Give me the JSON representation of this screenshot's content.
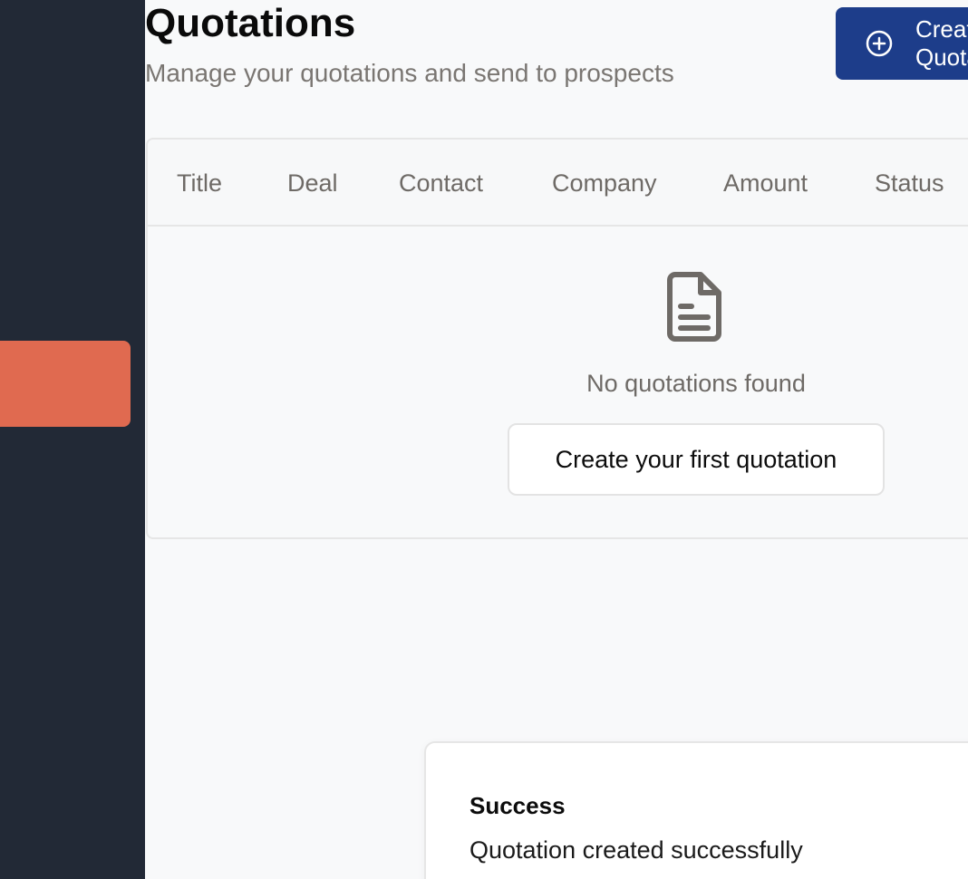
{
  "page": {
    "title": "Quotations",
    "subtitle": "Manage your quotations and send to prospects"
  },
  "actions": {
    "create_label": "Create Quotation",
    "create_icon": "plus-circle-icon"
  },
  "table": {
    "columns": [
      "Title",
      "Deal",
      "Contact",
      "Company",
      "Amount",
      "Status"
    ]
  },
  "empty_state": {
    "icon": "document-icon",
    "message": "No quotations found",
    "button_label": "Create your first quotation"
  },
  "toast": {
    "title": "Success",
    "message": "Quotation created successfully"
  },
  "colors": {
    "sidebar": "#222936",
    "sidebar_active": "#e06a50",
    "primary": "#1d3d8a",
    "background": "#f8f9fa"
  }
}
